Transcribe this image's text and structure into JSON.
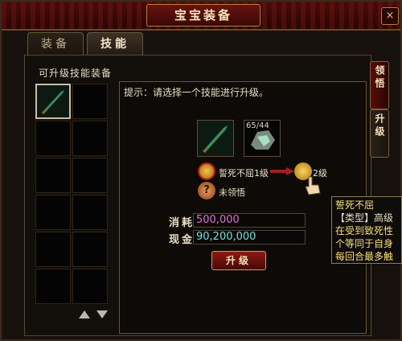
{
  "window": {
    "title": "宝宝装备",
    "close_glyph": "×"
  },
  "tabs": [
    {
      "label": "装备"
    },
    {
      "label": "技能"
    }
  ],
  "active_tab": "技能",
  "equip_list": {
    "label": "可升级技能装备",
    "selected_index": 0,
    "cell_count": 12
  },
  "hint": "提示：请选择一个技能进行升级。",
  "material": {
    "count_text": "65/44"
  },
  "skill": {
    "name_level": "誓死不屈1级",
    "next_level": "2级",
    "status": "未领悟"
  },
  "cost": {
    "label": "消耗",
    "value": "500,000"
  },
  "cash": {
    "label": "现金",
    "value": "90,200,000"
  },
  "upgrade_button": "升级",
  "side_tabs": [
    {
      "label": "领悟"
    },
    {
      "label": "升级"
    }
  ],
  "tooltip": {
    "name": "誓死不屈",
    "type_line": "【类型】高级",
    "desc": [
      "在受到致死性",
      "个等同于自身",
      "每回合最多触"
    ]
  },
  "colors": {
    "cost_value": "#e070d0",
    "cash_value": "#70e0e0",
    "tooltip_text": "#f6e07a",
    "title_bg": "#4a0a08"
  },
  "icons": [
    "sword-icon",
    "jade-ore-icon",
    "gold-fist-icon",
    "question-icon",
    "arrow-right-icon",
    "pointer-hand-icon",
    "scroll-up-icon",
    "scroll-down-icon"
  ]
}
